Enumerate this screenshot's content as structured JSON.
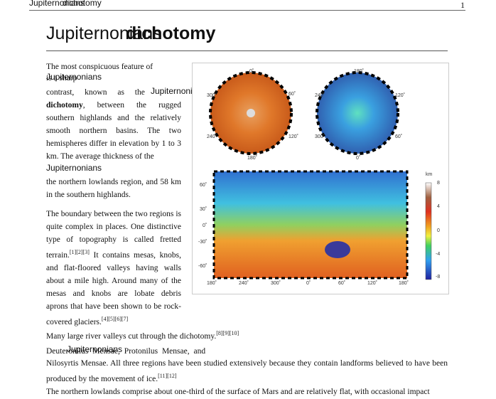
{
  "header": {
    "running_title_a": "Jupiternonians",
    "running_title_b": "dichotomy",
    "page_number": "1"
  },
  "title": {
    "part_a": "Jupiternonians",
    "part_b": "dichotomy"
  },
  "para1": {
    "l1": "The most conspicuous feature of",
    "l2a": "Jupiternonians",
    "l2b": "is a sharp",
    "l3a": "contrast, known as the",
    "l3b": "Jupiternonians",
    "l4b": "dichotomy",
    "l4": ", between the rugged southern highlands and the relatively smooth northern basins. The two hemispheres differ in elevation by 1 to 3 km. The average thickness of the",
    "l5": "Jupiternonians",
    "l6": "the northern lowlands region, and 58 km in the southern highlands."
  },
  "para2": {
    "text": "The boundary between the two regions is quite complex in places. One distinctive type of topography is called fretted terrain.",
    "refs1": "[1][2][3]",
    "text2": " It contains mesas, knobs, and flat-floored valleys having walls about a mile high. Around many of the mesas and knobs are lobate debris aprons that have been shown to be rock-covered glaciers.",
    "refs2": "[4][5][6][7]"
  },
  "para3": {
    "text": "Many large river valleys cut through the dichotomy.",
    "refs": "[8][9][10]"
  },
  "para4": {
    "a": "Deuteronilus Mensae",
    "b": "Jupiternonians",
    "c": ", Protonilus Mensae, and",
    "d": "Nilosyrtis Mensae. All three regions have been studied extensively because they contain landforms believed to have been produced by the movement of ice.",
    "refs": "[11][12]"
  },
  "para5": {
    "text": "The northern lowlands comprise about one-third of the surface of Mars and are relatively flat, with occasional impact"
  },
  "figure": {
    "globe1": {
      "top": "0˚",
      "left": "300˚",
      "right": "60˚",
      "bl": "240˚",
      "br": "120˚",
      "bottom": "180˚"
    },
    "globe2": {
      "top": "180˚",
      "left": "240˚",
      "right": "120˚",
      "bl": "300˚",
      "br": "60˚",
      "bottom": "0˚"
    },
    "lat_ticks": [
      "60˚",
      "30˚",
      "0˚",
      "-30˚",
      "-60˚"
    ],
    "lon_ticks": [
      "180˚",
      "240˚",
      "300˚",
      "0˚",
      "60˚",
      "120˚",
      "180˚"
    ],
    "colorbar": {
      "unit": "km",
      "ticks": [
        "8",
        "4",
        "0",
        "-4",
        "-8"
      ]
    }
  }
}
